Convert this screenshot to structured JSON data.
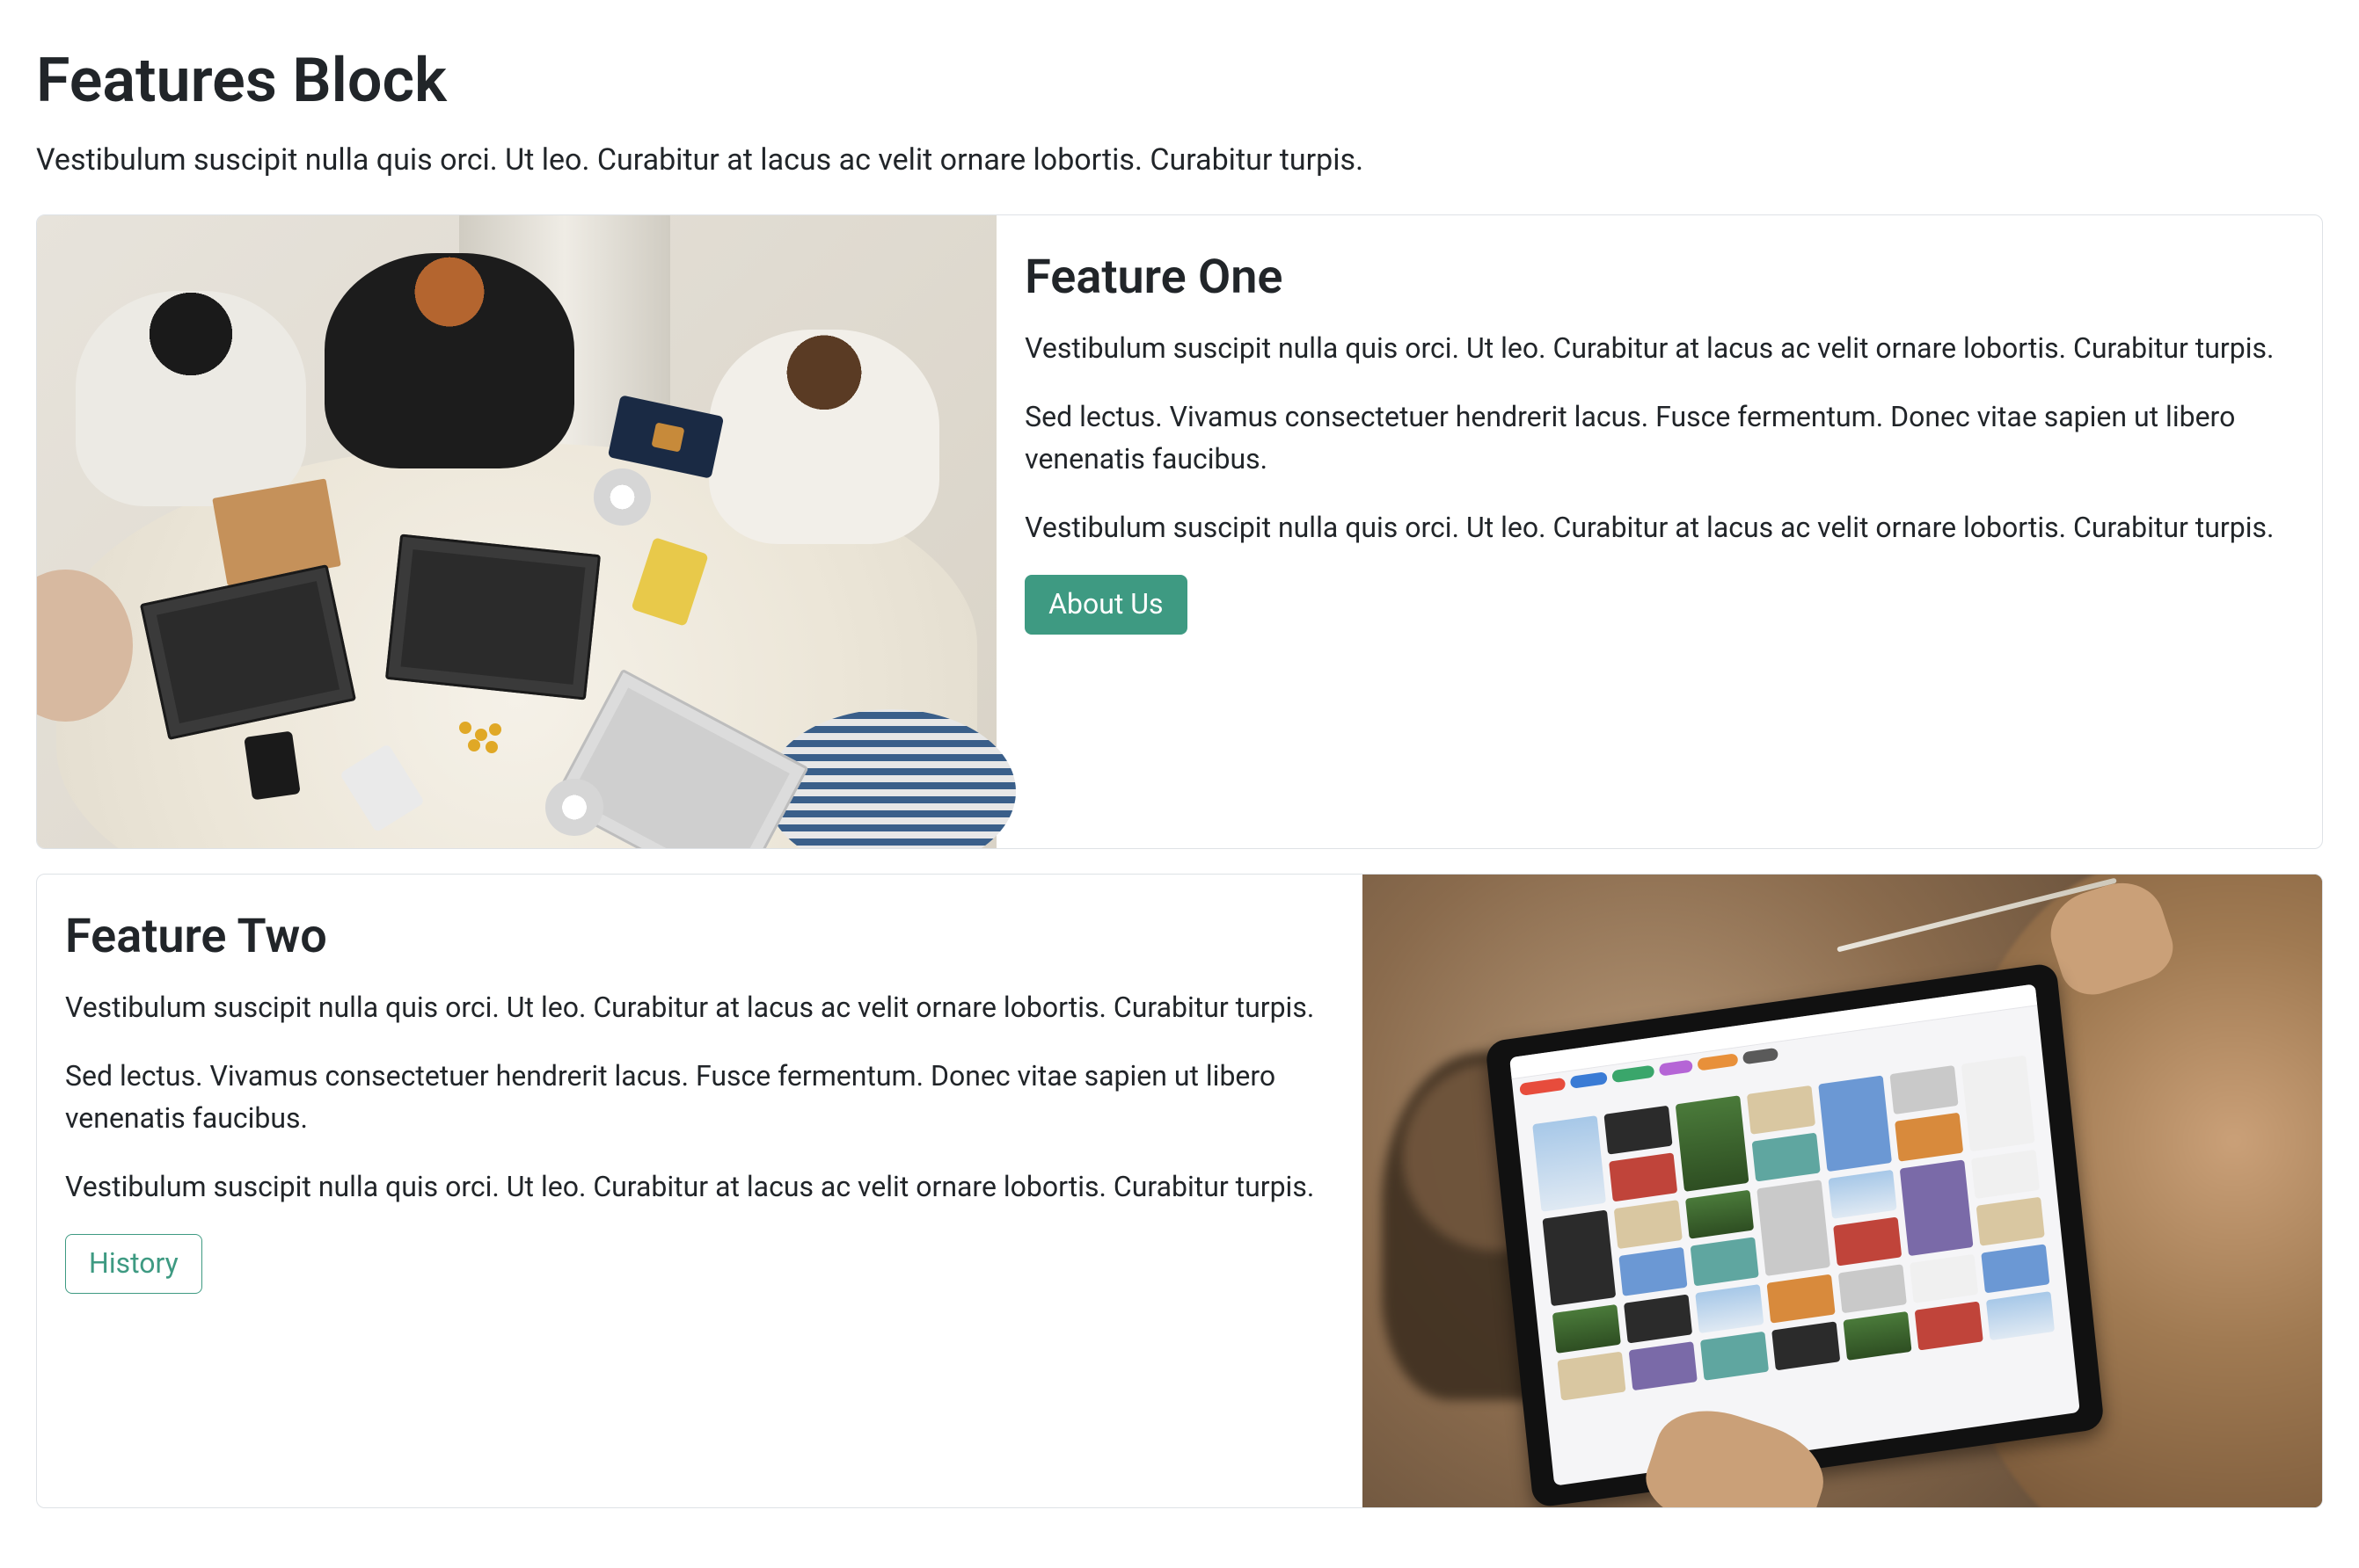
{
  "header": {
    "title": "Features Block",
    "subtitle": "Vestibulum suscipit nulla quis orci. Ut leo. Curabitur at lacus ac velit ornare lobortis. Curabitur turpis."
  },
  "features": [
    {
      "title": "Feature One",
      "paragraphs": [
        "Vestibulum suscipit nulla quis orci. Ut leo. Curabitur at lacus ac velit ornare lobortis. Curabitur turpis.",
        "Sed lectus. Vivamus consectetuer hendrerit lacus. Fusce fermentum. Donec vitae sapien ut libero venenatis faucibus.",
        "Vestibulum suscipit nulla quis orci. Ut leo. Curabitur at lacus ac velit ornare lobortis. Curabitur turpis."
      ],
      "button_label": "About Us",
      "button_style": "solid",
      "image_position": "left",
      "image_alt": "Top-down view of people with laptops around a table"
    },
    {
      "title": "Feature Two",
      "paragraphs": [
        "Vestibulum suscipit nulla quis orci. Ut leo. Curabitur at lacus ac velit ornare lobortis. Curabitur turpis.",
        "Sed lectus. Vivamus consectetuer hendrerit lacus. Fusce fermentum. Donec vitae sapien ut libero venenatis faucibus.",
        "Vestibulum suscipit nulla quis orci. Ut leo. Curabitur at lacus ac velit ornare lobortis. Curabitur turpis."
      ],
      "button_label": "History",
      "button_style": "outline",
      "image_position": "right",
      "image_alt": "Person holding a tablet showing an image grid"
    }
  ],
  "colors": {
    "accent": "#3e9a82",
    "text": "#212529",
    "border": "#dee2e6"
  }
}
